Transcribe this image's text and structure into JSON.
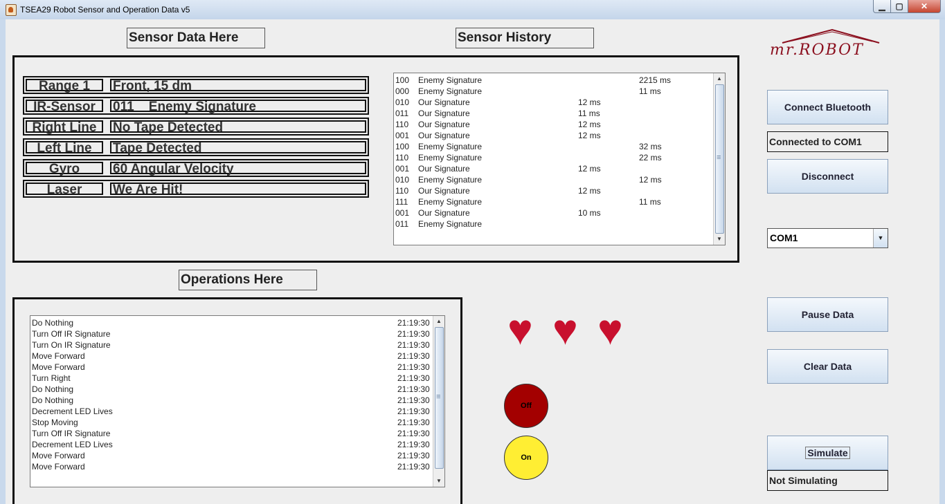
{
  "window": {
    "title": "TSEA29 Robot Sensor and Operation Data v5",
    "min": "▁",
    "max": "▢",
    "close": "✕"
  },
  "labels": {
    "sensor_data": "Sensor Data Here",
    "sensor_history": "Sensor History",
    "operations": "Operations Here"
  },
  "logo": {
    "text": "mr.ROBOT"
  },
  "sensors": [
    {
      "key": "Range 1",
      "value": "Front, 15 dm"
    },
    {
      "key": "IR-Sensor",
      "value": "011    Enemy Signature"
    },
    {
      "key": "Right Line",
      "value": "No Tape Detected"
    },
    {
      "key": "Left Line",
      "value": "Tape Detected"
    },
    {
      "key": "Gyro",
      "value": "60 Angular Velocity"
    },
    {
      "key": "Laser",
      "value": "We Are Hit!"
    }
  ],
  "history": [
    {
      "code": "100",
      "name": "Enemy Signature",
      "our": "",
      "enemy": "2215 ms"
    },
    {
      "code": "000",
      "name": "Enemy Signature",
      "our": "",
      "enemy": "11 ms"
    },
    {
      "code": "010",
      "name": "Our Signature",
      "our": "12 ms",
      "enemy": ""
    },
    {
      "code": "011",
      "name": "Our Signature",
      "our": "11 ms",
      "enemy": ""
    },
    {
      "code": "110",
      "name": "Our Signature",
      "our": "12 ms",
      "enemy": ""
    },
    {
      "code": "001",
      "name": "Our Signature",
      "our": "12 ms",
      "enemy": ""
    },
    {
      "code": "100",
      "name": "Enemy Signature",
      "our": "",
      "enemy": "32 ms"
    },
    {
      "code": "110",
      "name": "Enemy Signature",
      "our": "",
      "enemy": "22 ms"
    },
    {
      "code": "001",
      "name": "Our Signature",
      "our": "12 ms",
      "enemy": ""
    },
    {
      "code": "010",
      "name": "Enemy Signature",
      "our": "",
      "enemy": "12 ms"
    },
    {
      "code": "110",
      "name": "Our Signature",
      "our": "12 ms",
      "enemy": ""
    },
    {
      "code": "111",
      "name": "Enemy Signature",
      "our": "",
      "enemy": "11 ms"
    },
    {
      "code": "001",
      "name": "Our Signature",
      "our": "10 ms",
      "enemy": ""
    },
    {
      "code": "011",
      "name": "Enemy Signature",
      "our": "",
      "enemy": ""
    }
  ],
  "operations": [
    {
      "op": "Do Nothing",
      "time": "21:19:30"
    },
    {
      "op": "Turn Off IR Signature",
      "time": "21:19:30"
    },
    {
      "op": "Turn On IR Signature",
      "time": "21:19:30"
    },
    {
      "op": "Move Forward",
      "time": "21:19:30"
    },
    {
      "op": "Move Forward",
      "time": "21:19:30"
    },
    {
      "op": "Turn Right",
      "time": "21:19:30"
    },
    {
      "op": "Do Nothing",
      "time": "21:19:30"
    },
    {
      "op": "Do Nothing",
      "time": "21:19:30"
    },
    {
      "op": "Decrement LED Lives",
      "time": "21:19:30"
    },
    {
      "op": "Stop Moving",
      "time": "21:19:30"
    },
    {
      "op": "Turn Off IR Signature",
      "time": "21:19:30"
    },
    {
      "op": "Decrement LED Lives",
      "time": "21:19:30"
    },
    {
      "op": "Move Forward",
      "time": "21:19:30"
    },
    {
      "op": "Move Forward",
      "time": "21:19:30"
    }
  ],
  "controls": {
    "connect": "Connect Bluetooth",
    "connection_status": "Connected to COM1",
    "disconnect": "Disconnect",
    "port": "COM1",
    "pause": "Pause Data",
    "clear": "Clear Data",
    "simulate": "Simulate",
    "sim_status": "Not Simulating"
  },
  "lives": {
    "hearts": 3,
    "heart_glyph": "♥",
    "heart_color": "#c8102e"
  },
  "leds": [
    {
      "label": "Off",
      "color": "#a30000"
    },
    {
      "label": "On",
      "color": "#ffee33"
    }
  ]
}
